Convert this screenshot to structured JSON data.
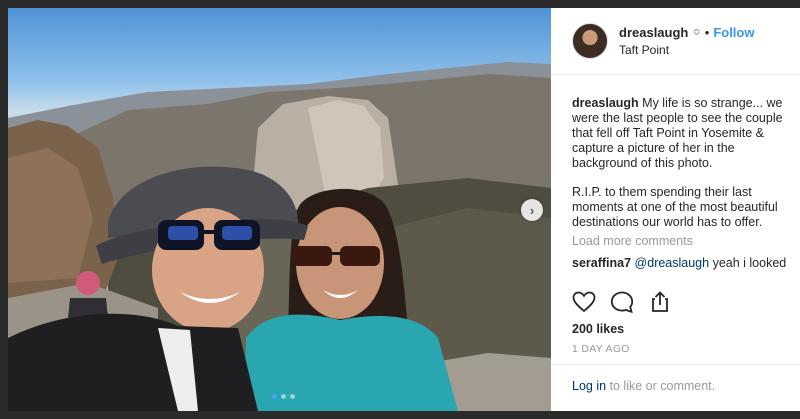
{
  "post": {
    "username": "dreaslaugh",
    "verify_glyph": "≎",
    "bullet": "•",
    "follow_label": "Follow",
    "location": "Taft Point"
  },
  "caption": {
    "user": "dreaslaugh",
    "line1": " My life is so strange... we",
    "line2": "were the last people to see the couple",
    "line3": "that fell off Taft Point in Yosemite &",
    "line4": "capture a picture of her in the",
    "line5": "background of this photo.",
    "line6": "R.I.P. to them spending their last",
    "line7": "moments at one of the most beautiful",
    "line8": "destinations our world has to offer."
  },
  "load_more": "Load more comments",
  "comment": {
    "user": "seraffina7",
    "mention": "@dreaslaugh",
    "text": " yeah i looked"
  },
  "likes": "200 likes",
  "date": "1 DAY AGO",
  "footer": {
    "login": "Log in",
    "rest": " to like or comment."
  },
  "carousel": {
    "next_glyph": "›",
    "page_count": 3,
    "current_page": 1
  },
  "icons": {
    "like": "heart-icon",
    "comment": "comment-bubble-icon",
    "share": "share-icon"
  },
  "colors": {
    "link": "#3897f0",
    "mention": "#003569",
    "muted": "#999999",
    "text": "#262626"
  }
}
